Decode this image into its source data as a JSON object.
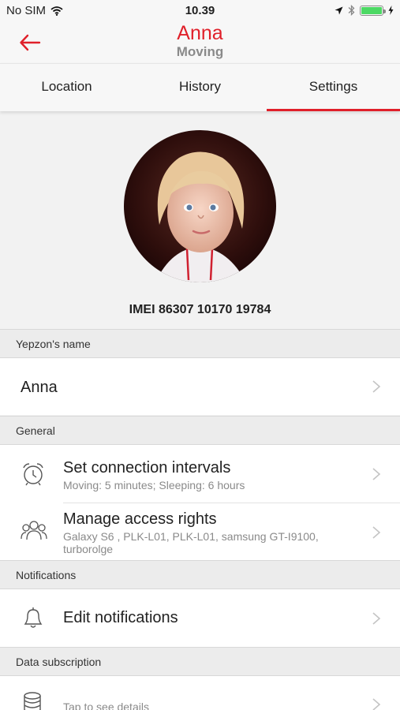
{
  "status_bar": {
    "carrier": "No SIM",
    "time": "10.39"
  },
  "header": {
    "title": "Anna",
    "subtitle": "Moving"
  },
  "tabs": [
    {
      "label": "Location"
    },
    {
      "label": "History"
    },
    {
      "label": "Settings"
    }
  ],
  "device": {
    "imei": "IMEI 86307 10170 19784"
  },
  "sections": {
    "name": {
      "header": "Yepzon's name",
      "value": "Anna"
    },
    "general": {
      "header": "General",
      "intervals": {
        "title": "Set connection intervals",
        "subtitle": "Moving: 5 minutes; Sleeping: 6 hours"
      },
      "access": {
        "title": "Manage access rights",
        "subtitle_line1": "Galaxy S6 , PLK-L01, PLK-L01, samsung GT-I9100,",
        "subtitle_line2": "turborolge"
      }
    },
    "notifications": {
      "header": "Notifications",
      "edit": {
        "title": "Edit notifications"
      }
    },
    "data_subscription": {
      "header": "Data subscription",
      "details": {
        "subtitle": "Tap to see details"
      }
    }
  },
  "colors": {
    "accent": "#e0202a",
    "battery": "#4cd964"
  },
  "icons": [
    "back-arrow-icon",
    "wifi-icon",
    "location-arrow-icon",
    "bluetooth-icon",
    "battery-icon",
    "charging-icon",
    "alarm-clock-icon",
    "people-icon",
    "bell-icon",
    "database-icon",
    "chevron-right-icon"
  ]
}
